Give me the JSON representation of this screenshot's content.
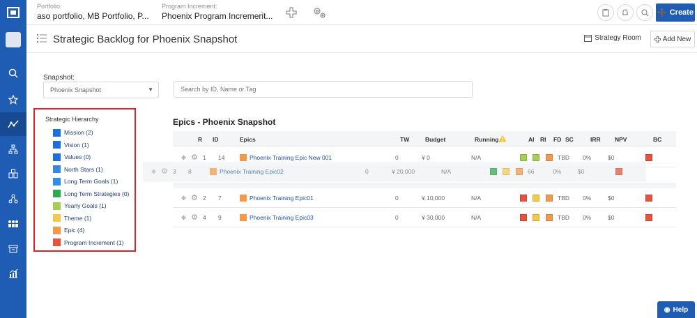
{
  "topbar": {
    "portfolio_label": "Portfolio:",
    "portfolio_value": "aso portfolio, MB Portfolio, P...",
    "pi_label": "Program Increment:",
    "pi_value": "Phoenix Program Increment...",
    "create_label": "Create"
  },
  "page": {
    "title": "Strategic Backlog for Phoenix Snapshot",
    "strategy_room": "Strategy Room",
    "add_new": "Add New"
  },
  "snapshot": {
    "label": "Snapshot:",
    "selected": "Phoenix Snapshot",
    "search_placeholder": "Search by ID, Name or Tag"
  },
  "hierarchy": {
    "title": "Strategic Hierarchy",
    "items": [
      {
        "label": "Mission (2)",
        "color": "#1e6fd9"
      },
      {
        "label": "Vision (1)",
        "color": "#1e6fd9"
      },
      {
        "label": "Values (0)",
        "color": "#1e6fd9"
      },
      {
        "label": "North Stars (1)",
        "color": "#3a87e0"
      },
      {
        "label": "Long Term Goals (1)",
        "color": "#2f8fe8"
      },
      {
        "label": "Long Term Strategies (0)",
        "color": "#2fa84f"
      },
      {
        "label": "Yearly Goals (1)",
        "color": "#a5cf54"
      },
      {
        "label": "Theme (1)",
        "color": "#f2c94c"
      },
      {
        "label": "Epic (4)",
        "color": "#f2994a"
      },
      {
        "label": "Program Increment (1)",
        "color": "#e5533d"
      }
    ]
  },
  "epics": {
    "title": "Epics - Phoenix Snapshot",
    "headers": {
      "r": "R",
      "id": "ID",
      "epics": "Epics",
      "tw": "TW",
      "budget": "Budget",
      "running": "Running",
      "ai": "AI",
      "ri": "RI",
      "fd": "FD",
      "sc": "SC",
      "irr": "IRR",
      "npv": "NPV",
      "bc": "BC"
    },
    "rows": [
      {
        "r": "1",
        "id": "14",
        "name": "Phoenix Training Epic New 001",
        "tw": "0",
        "budget": "¥ 0",
        "running": "N/A",
        "sc": "TBD",
        "irr": "0%",
        "npv": "$0",
        "ai": "#a5cf54",
        "ri": "#a5cf54",
        "fd": "#f2994a",
        "bc": "#e5533d"
      },
      {
        "r": "3",
        "id": "8",
        "name": "Phoenix Training Epic02",
        "tw": "0",
        "budget": "¥ 20,000",
        "running": "N/A",
        "sc": "66",
        "irr": "0%",
        "npv": "$0",
        "ai": "#2fa84f",
        "ri": "#f2c94c",
        "fd": "#f2994a",
        "bc": "#e5533d"
      },
      {
        "r": "2",
        "id": "7",
        "name": "Phoenix Training Epic01",
        "tw": "0",
        "budget": "¥ 10,000",
        "running": "N/A",
        "sc": "TBD",
        "irr": "0%",
        "npv": "$0",
        "ai": "#e5533d",
        "ri": "#f2c94c",
        "fd": "#f2994a",
        "bc": "#e5533d"
      },
      {
        "r": "4",
        "id": "9",
        "name": "Phoenix Training Epic03",
        "tw": "0",
        "budget": "¥ 30,000",
        "running": "N/A",
        "sc": "TBD",
        "irr": "0%",
        "npv": "$0",
        "ai": "#e5533d",
        "ri": "#f2c94c",
        "fd": "#f2994a",
        "bc": "#e5533d"
      }
    ]
  },
  "help_label": "Help",
  "icons": [
    "logo-icon",
    "search-icon",
    "star-icon",
    "strategy-icon",
    "hierarchy-icon",
    "portfolio-icon",
    "network-icon",
    "team-icon",
    "archive-icon",
    "chart-icon",
    "plus-cross-icon",
    "gears-icon",
    "clipboard-icon",
    "bell-icon",
    "move-icon",
    "gear-icon",
    "warning-icon"
  ]
}
